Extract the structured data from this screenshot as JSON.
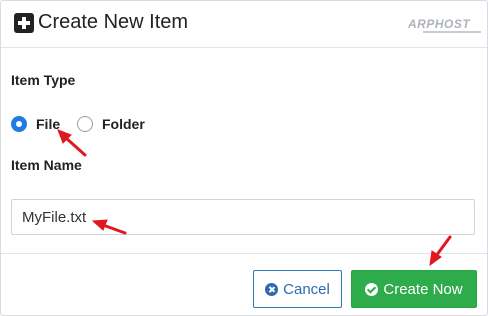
{
  "dialog": {
    "title": "Create New Item",
    "watermark": "ARPHOST"
  },
  "item_type": {
    "label": "Item Type",
    "options": [
      {
        "label": "File",
        "selected": true
      },
      {
        "label": "Folder",
        "selected": false
      }
    ]
  },
  "item_name": {
    "label": "Item Name",
    "value": "MyFile.txt"
  },
  "buttons": {
    "cancel": "Cancel",
    "create": "Create Now"
  },
  "colors": {
    "accent_blue": "#1e7ce3",
    "create_green": "#2eab4b",
    "annotation_red": "#e0191f"
  },
  "icons": {
    "header": "plus-square-icon",
    "cancel": "times-circle-icon",
    "create": "check-circle-icon",
    "annotation": "red-arrow-icon"
  }
}
